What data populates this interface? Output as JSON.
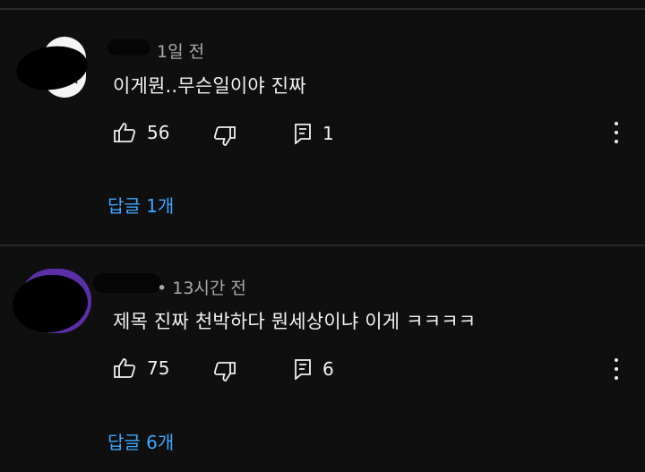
{
  "comments": [
    {
      "time": "1일 전",
      "text": "이게뭔..무슨일이야 진짜",
      "likes": "56",
      "reply_count": "1",
      "replies_label": "답글 1개",
      "like_icon": "thumb-up-icon",
      "dislike_icon": "thumb-down-icon",
      "reply_icon": "comment-icon",
      "more_icon": "more-vert-icon"
    },
    {
      "time": "• 13시간 전",
      "text": "제목 진짜 천박하다 뭔세상이냐 이게 ㅋㅋㅋㅋ",
      "likes": "75",
      "reply_count": "6",
      "replies_label": "답글 6개",
      "like_icon": "thumb-up-icon",
      "dislike_icon": "thumb-down-icon",
      "reply_icon": "comment-icon",
      "more_icon": "more-vert-icon"
    }
  ],
  "colors": {
    "background": "#0f0f0f",
    "text": "#f1f1f1",
    "meta": "#aaaaaa",
    "link": "#3ea6ff",
    "avatar2": "#5b2fa8"
  }
}
